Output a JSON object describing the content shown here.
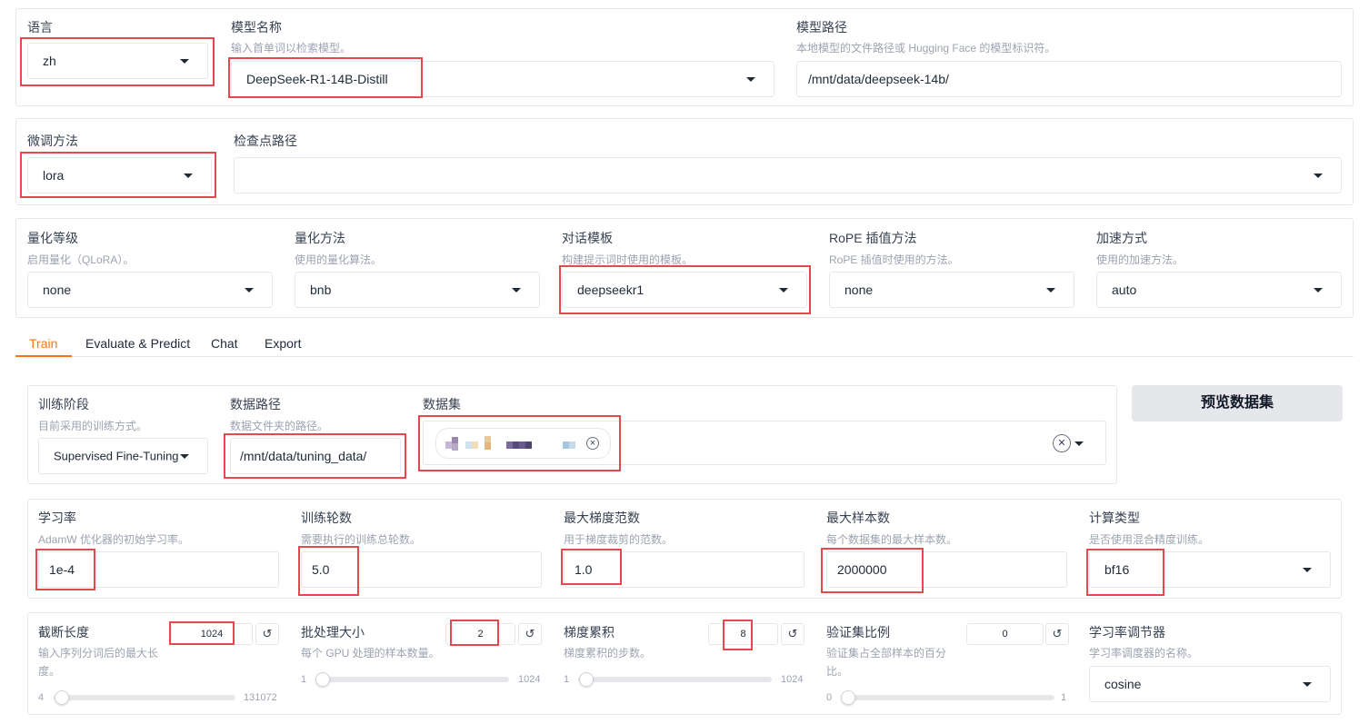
{
  "top": {
    "lang_label": "语言",
    "lang_value": "zh",
    "model_name_label": "模型名称",
    "model_name_hint": "输入首单词以检索模型。",
    "model_name_value": "DeepSeek-R1-14B-Distill",
    "model_path_label": "模型路径",
    "model_path_hint": "本地模型的文件路径或 Hugging Face 的模型标识符。",
    "model_path_value": "/mnt/data/deepseek-14b/"
  },
  "finetune": {
    "method_label": "微调方法",
    "method_value": "lora",
    "ckpt_label": "检查点路径",
    "ckpt_value": ""
  },
  "advanced": {
    "quant_bit_label": "量化等级",
    "quant_bit_hint": "启用量化（QLoRA）。",
    "quant_bit_value": "none",
    "quant_method_label": "量化方法",
    "quant_method_hint": "使用的量化算法。",
    "quant_method_value": "bnb",
    "template_label": "对话模板",
    "template_hint": "构建提示词时使用的模板。",
    "template_value": "deepseekr1",
    "rope_label": "RoPE 插值方法",
    "rope_hint": "RoPE 插值时使用的方法。",
    "rope_value": "none",
    "booster_label": "加速方式",
    "booster_hint": "使用的加速方法。",
    "booster_value": "auto"
  },
  "tabs": [
    {
      "label": "Train"
    },
    {
      "label": "Evaluate & Predict"
    },
    {
      "label": "Chat"
    },
    {
      "label": "Export"
    }
  ],
  "train": {
    "stage_label": "训练阶段",
    "stage_hint": "目前采用的训练方式。",
    "stage_value": "Supervised Fine-Tuning",
    "dataset_dir_label": "数据路径",
    "dataset_dir_hint": "数据文件夹的路径。",
    "dataset_dir_value": "/mnt/data/tuning_data/",
    "dataset_label": "数据集",
    "preview_button": "预览数据集",
    "lr_label": "学习率",
    "lr_hint": "AdamW 优化器的初始学习率。",
    "lr_value": "1e-4",
    "epochs_label": "训练轮数",
    "epochs_hint": "需要执行的训练总轮数。",
    "epochs_value": "5.0",
    "grad_norm_label": "最大梯度范数",
    "grad_norm_hint": "用于梯度裁剪的范数。",
    "grad_norm_value": "1.0",
    "max_samples_label": "最大样本数",
    "max_samples_hint": "每个数据集的最大样本数。",
    "max_samples_value": "2000000",
    "compute_type_label": "计算类型",
    "compute_type_hint": "是否使用混合精度训练。",
    "compute_type_value": "bf16",
    "cutoff_label": "截断长度",
    "cutoff_hint_1": "输入序列分词后的最大长",
    "cutoff_hint_2": "度。",
    "cutoff_value": "1024",
    "cutoff_min": "4",
    "cutoff_max": "131072",
    "cutoff_fraction": 0.0078,
    "batch_label": "批处理大小",
    "batch_hint": "每个 GPU 处理的样本数量。",
    "batch_value": "2",
    "batch_min": "1",
    "batch_max": "1024",
    "batch_fraction": 0.001,
    "grad_accum_label": "梯度累积",
    "grad_accum_hint": "梯度累积的步数。",
    "grad_accum_value": "8",
    "grad_accum_min": "1",
    "grad_accum_max": "1024",
    "grad_accum_fraction": 0.007,
    "val_label": "验证集比例",
    "val_hint_1": "验证集占全部样本的百分",
    "val_hint_2": "比。",
    "val_value": "0",
    "val_min": "0",
    "val_max": "1",
    "val_fraction": 0,
    "scheduler_label": "学习率调节器",
    "scheduler_hint": "学习率调度器的名称。",
    "scheduler_value": "cosine",
    "reset_glyph": "↺",
    "chip_close_glyph": "×",
    "clear_glyph": "✕"
  },
  "colors": {
    "accent": "#f97316",
    "highlight": "#e5484d",
    "border": "#e5e7eb",
    "hint_text": "#9ca3af",
    "button_bg": "#e5e7eb"
  }
}
